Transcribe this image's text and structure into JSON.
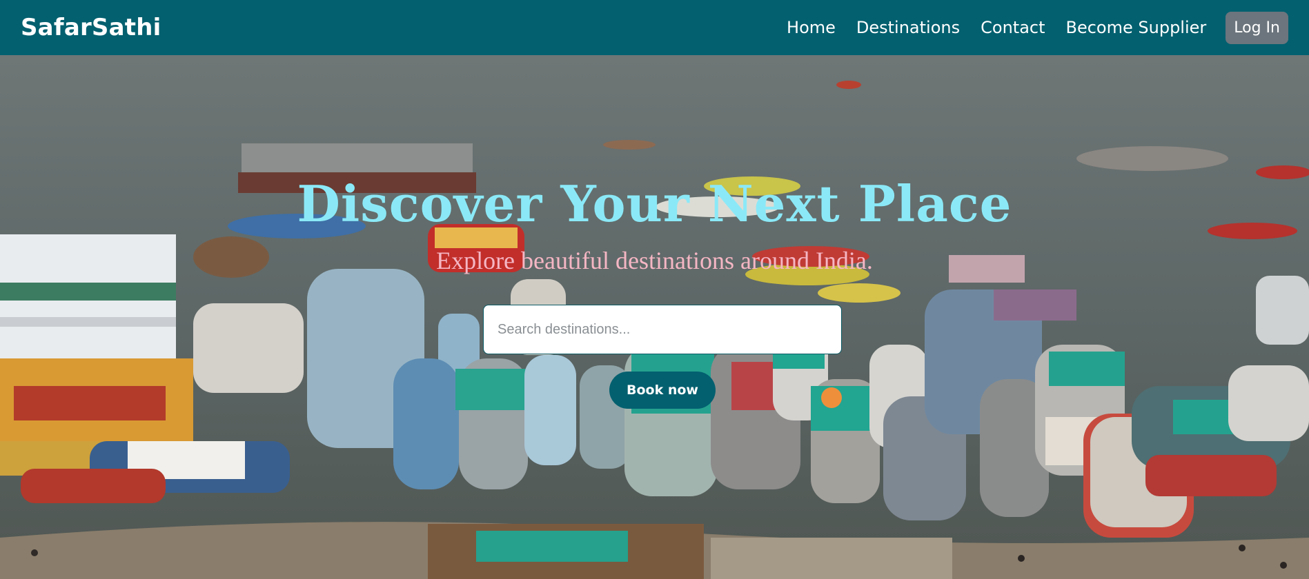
{
  "navbar": {
    "brand": "SafarSathi",
    "links": [
      "Home",
      "Destinations",
      "Contact",
      "Become Supplier"
    ],
    "login_label": "Log In"
  },
  "hero": {
    "title": "Discover Your Next Place",
    "subtitle": "Explore beautiful destinations around India.",
    "search_placeholder": "Search destinations...",
    "book_label": "Book now"
  },
  "colors": {
    "navbar_bg": "#03606f",
    "title": "#8be9f7",
    "subtitle": "#f5b6c4",
    "book_button": "#03606f",
    "login_button": "#6c757d"
  }
}
